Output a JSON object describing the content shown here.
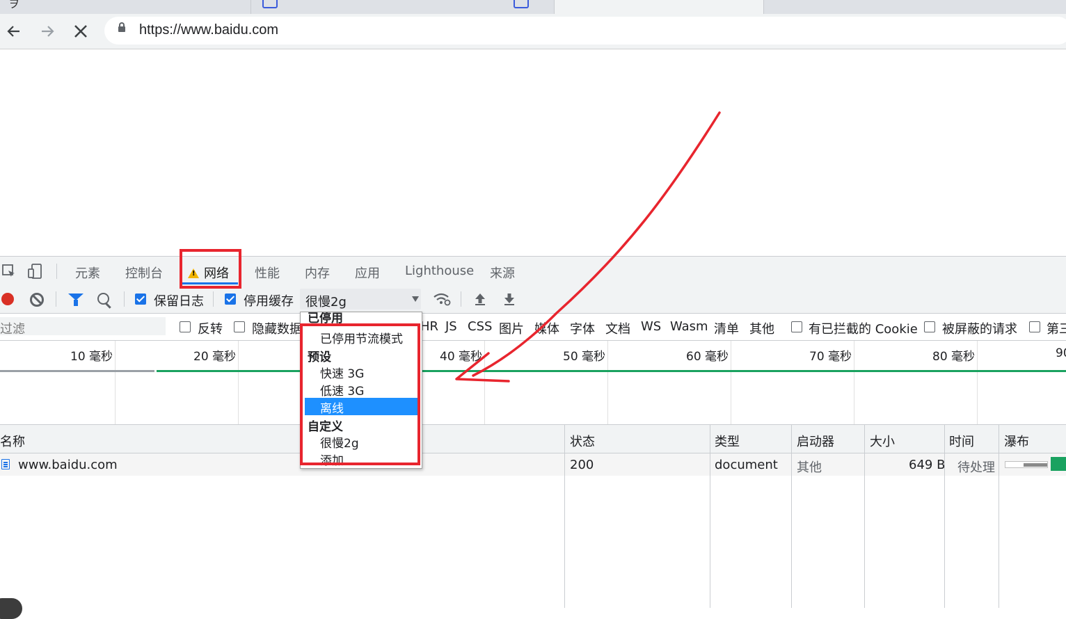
{
  "browser": {
    "url": "https://www.baidu.com",
    "back_icon": "arrow-left-icon",
    "forward_icon": "arrow-right-icon",
    "stop_icon": "close-icon"
  },
  "devtools": {
    "tabs": [
      {
        "label": "元素"
      },
      {
        "label": "控制台"
      },
      {
        "label": "网络",
        "active": true,
        "warning": true
      },
      {
        "label": "性能"
      },
      {
        "label": "内存"
      },
      {
        "label": "应用"
      },
      {
        "label": "Lighthouse"
      },
      {
        "label": "来源"
      }
    ],
    "toolbar": {
      "preserve_log_label": "保留日志",
      "preserve_log_checked": true,
      "disable_cache_label": "停用缓存",
      "disable_cache_checked": true,
      "throttle_value": "很慢2g"
    },
    "filter": {
      "placeholder": "过滤",
      "invert_label": "反转",
      "hide_data_label": "隐藏数据",
      "types": [
        "HR",
        "JS",
        "CSS",
        "图片",
        "媒体",
        "字体",
        "文档",
        "WS",
        "Wasm",
        "清单",
        "其他"
      ],
      "blocked_cookies_label": "有已拦截的 Cookie",
      "blocked_requests_label": "被屏蔽的请求",
      "third_party_label": "第三"
    },
    "overview": {
      "ticks": [
        "10 毫秒",
        "20 毫秒",
        "40 毫秒",
        "50 毫秒",
        "60 毫秒",
        "70 毫秒",
        "80 毫秒",
        "90"
      ]
    },
    "table": {
      "headers": {
        "name": "名称",
        "status": "状态",
        "type": "类型",
        "initiator": "启动器",
        "size": "大小",
        "time": "时间",
        "waterfall": "瀑布"
      },
      "rows": [
        {
          "name": "www.baidu.com",
          "status": "200",
          "type": "document",
          "initiator": "其他",
          "size": "649 B",
          "time": "待处理"
        }
      ]
    },
    "throttle_dropdown": {
      "groups": [
        {
          "title": "已停用",
          "items": [
            "已停用节流模式"
          ]
        },
        {
          "title": "预设",
          "items": [
            "快速 3G",
            "低速 3G",
            "离线"
          ]
        },
        {
          "title": "自定义",
          "items": [
            "很慢2g",
            "添加..."
          ]
        }
      ],
      "selected": "离线"
    }
  },
  "colors": {
    "accent": "#1a73e8",
    "record": "#d93025",
    "annotation": "#e8252e",
    "selected_item": "#1e90ff",
    "waterfall_green": "#1aa260"
  }
}
